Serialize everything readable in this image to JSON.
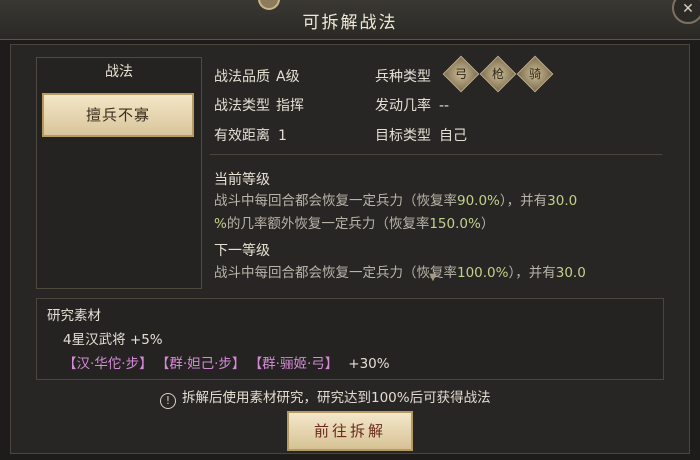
{
  "header": {
    "title": "可拆解战法",
    "close_icon": "close-icon"
  },
  "tactic_list": {
    "heading": "战法",
    "selected": "擅兵不寡"
  },
  "info": {
    "quality_label": "战法品质",
    "quality_value": "A级",
    "type_label": "战法类型",
    "type_value": "指挥",
    "range_label": "有效距离",
    "range_value": "1",
    "troop_label": "兵种类型",
    "troop_icons": [
      "bow-soldier-icon",
      "spear-soldier-icon",
      "cavalry-icon"
    ],
    "trigger_label": "发动几率",
    "trigger_value": "--",
    "target_label": "目标类型",
    "target_value": "自己"
  },
  "current_level": {
    "title": "当前等级",
    "line1_a": "战斗中每回合都会恢复一定兵力（恢复率",
    "line1_b": "90.0%",
    "line1_c": "），并有",
    "line1_d": "30.0",
    "line2_a": "%",
    "line2_b": "的几率额外恢复一定兵力（恢复率",
    "line2_c": "150.0%",
    "line2_d": "）"
  },
  "next_level": {
    "title": "下一等级",
    "line1_a": "战斗中每回合都会恢复一定兵力（恢复率",
    "line1_b": "100.0%",
    "line1_c": "），并有",
    "line1_d": "30.0"
  },
  "materials": {
    "title": "研究素材",
    "line1": "4星汉武将 +5%",
    "heroes": [
      "【汉·华佗·步】",
      "【群·妲己·步】",
      "【群·骊姬·弓】"
    ],
    "bonus": "+30%"
  },
  "notice": "拆解后使用素材研究，研究达到100%后可获得战法",
  "go_button": "前往拆解"
}
